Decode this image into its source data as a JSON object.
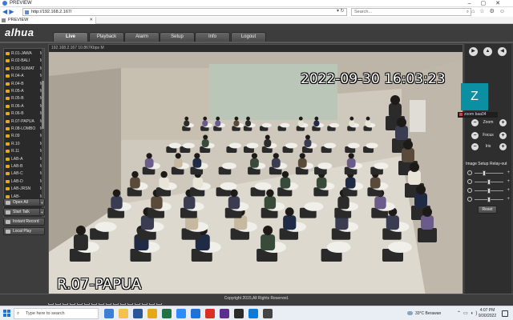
{
  "browser": {
    "title": "PREVIEW",
    "url": "http://192.168.2.167/",
    "search_placeholder": "Search...",
    "tab_label": "PREVIEW"
  },
  "app": {
    "logo": "alhua",
    "tabs": [
      "Live",
      "Playback",
      "Alarm",
      "Setup",
      "Info",
      "Logout"
    ],
    "active_tab": "Live"
  },
  "sidebar": {
    "cameras": [
      {
        "label": "R.01-JAWA",
        "flag": "M"
      },
      {
        "label": "R.02-BALI",
        "flag": "M"
      },
      {
        "label": "R.03-SUMAT",
        "flag": "M"
      },
      {
        "label": "R.04-A",
        "flag": "M"
      },
      {
        "label": "R.04-B",
        "flag": "M"
      },
      {
        "label": "R.05-A",
        "flag": "M"
      },
      {
        "label": "R.05-B",
        "flag": "M"
      },
      {
        "label": "R.06-A",
        "flag": "M"
      },
      {
        "label": "R.06-B",
        "flag": "M"
      },
      {
        "label": "R.07-PAPUA",
        "flag": "M"
      },
      {
        "label": "R.08-LOMBO",
        "flag": "M"
      },
      {
        "label": "R.09",
        "flag": "M"
      },
      {
        "label": "R.10",
        "flag": "M"
      },
      {
        "label": "R.11",
        "flag": "M"
      },
      {
        "label": "LAB-A",
        "flag": "M"
      },
      {
        "label": "LAB-B",
        "flag": "M"
      },
      {
        "label": "LAB-C",
        "flag": "M"
      },
      {
        "label": "LAB-D",
        "flag": "M"
      },
      {
        "label": "LAB-JRSN",
        "flag": "M"
      },
      {
        "label": "LAB-",
        "flag": "M"
      }
    ],
    "buttons": {
      "open_all": "Open All",
      "start_talk": "Start Talk",
      "instant_record": "Instant Record",
      "local_play": "Local Play"
    }
  },
  "video": {
    "info": "192.168.2.167 10.867Kbps M",
    "timestamp": "2022-09-30 16:03:23",
    "channel_label": "R.07-PAPUA"
  },
  "ptz": {
    "zoom_label": "Zoom",
    "focus_label": "Focus",
    "iris_label": "Iris",
    "image_setup_tab": "Image Setup",
    "relay_out_tab": "Relay-out",
    "reset_label": "Reset",
    "slider_levels": [
      0.3,
      0.5,
      0.5,
      0.5
    ]
  },
  "zoom_popup": {
    "initial": "Z",
    "label": "zoom baa04",
    "color": "#0b8fa3"
  },
  "copyright": "Copyright 2015,All Rights Reserved.",
  "taskbar": {
    "search_placeholder": "Type here to search",
    "weather": "33°C  Berawan",
    "time": "4:07 PM",
    "date": "9/30/2022"
  },
  "colors": {
    "app_bg": "#3d3d3d",
    "camera_icon": "#e6a817",
    "brand_red": "#e53935"
  }
}
